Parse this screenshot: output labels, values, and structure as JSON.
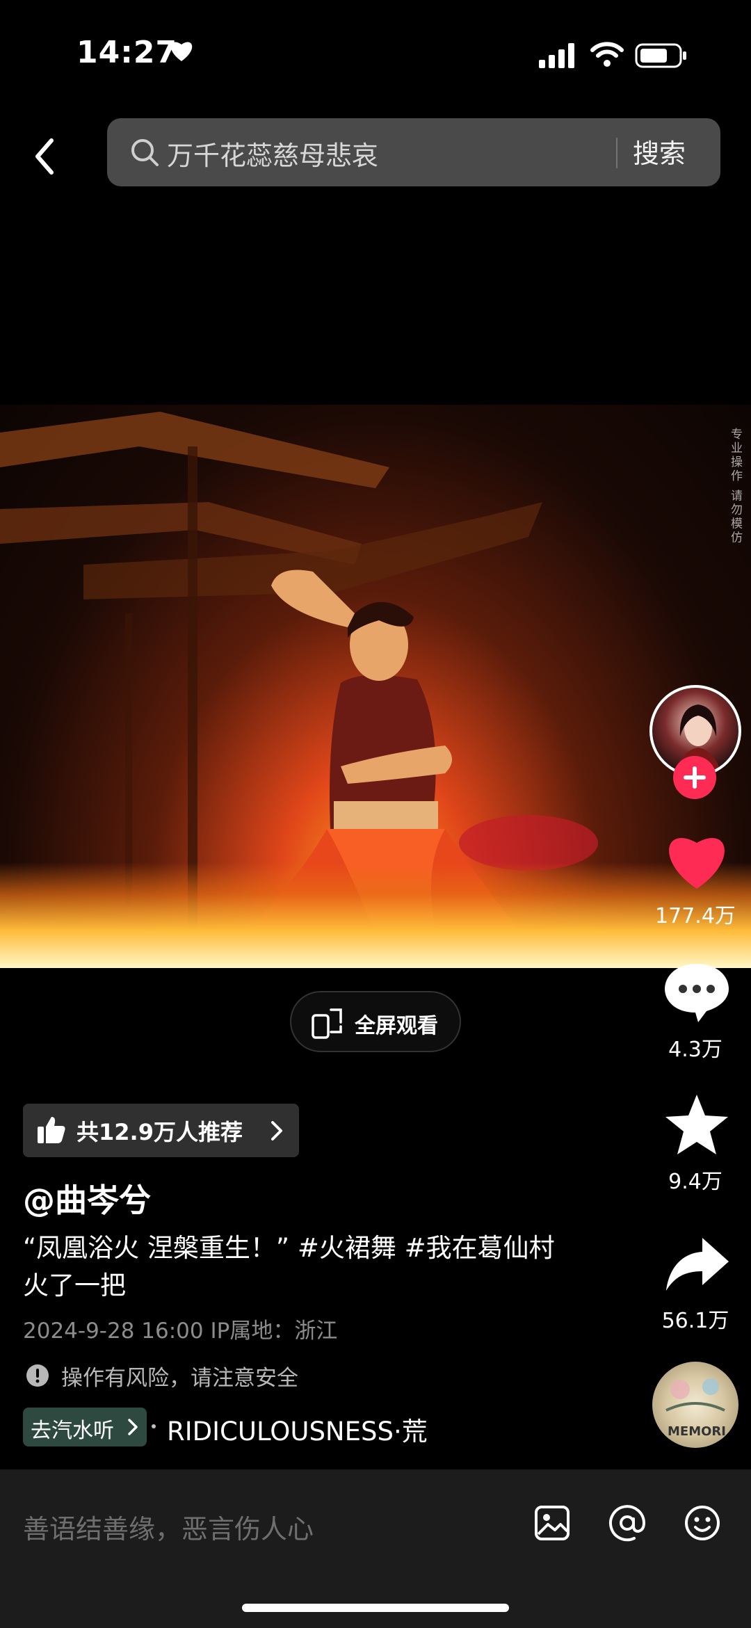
{
  "status_bar": {
    "time": "14:27"
  },
  "search": {
    "query": "万千花蕊慈母悲哀",
    "button": "搜索"
  },
  "watermark": "专业操作 请勿模仿",
  "actions": {
    "likes": "177.4万",
    "comments": "4.3万",
    "favorites": "9.4万",
    "shares": "56.1万"
  },
  "fullscreen_label": "全屏观看",
  "recommend_label": "共12.9万人推荐",
  "author": "@曲岑兮",
  "description": "“凤凰浴火 涅槃重生！” #火裙舞 #我在葛仙村火了一把",
  "meta": "2024-9-28 16:00   IP属地：浙江",
  "risk_notice": "操作有风险，请注意安全",
  "music": {
    "button": "去汽水听",
    "title": "RIDICULOUSNESS·荒",
    "disc_label": "MEMORI"
  },
  "comment_placeholder": "善语结善缘，恶言伤人心",
  "colors": {
    "accent": "#fe2c55",
    "like": "#fe2c55"
  }
}
